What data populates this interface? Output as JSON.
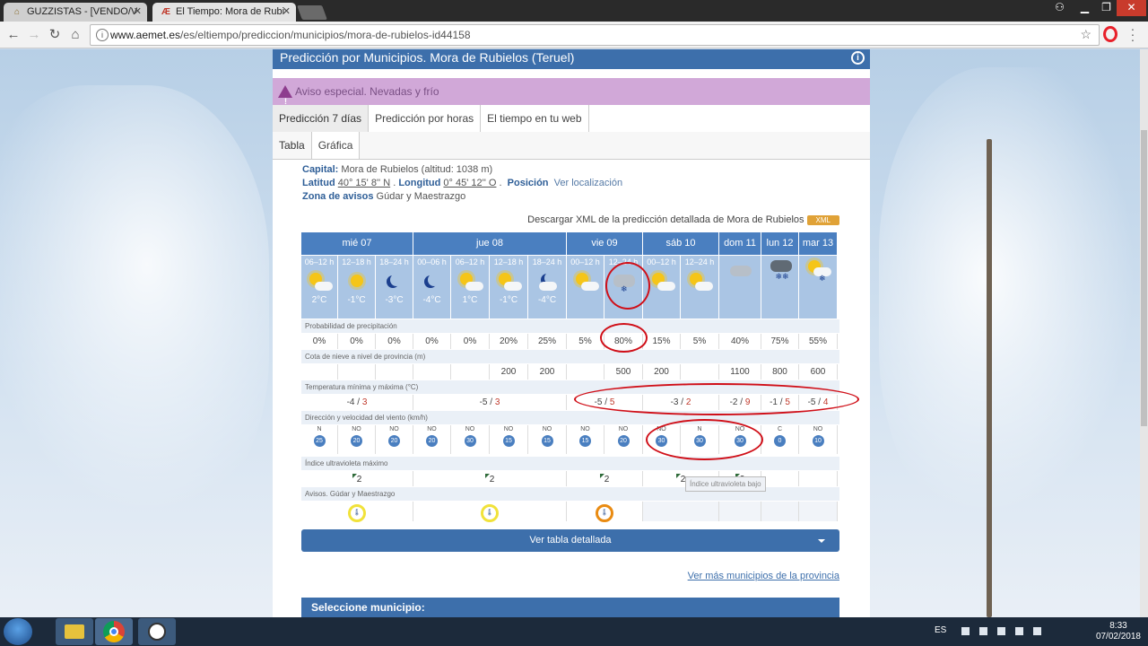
{
  "browser": {
    "tabs": [
      {
        "title": "GUZZISTAS - [VENDO/V",
        "active": false,
        "favicon": "guzzi-icon"
      },
      {
        "title": "El Tiempo: Mora de Rubi",
        "active": true,
        "favicon": "aemet-icon"
      }
    ],
    "url_domain": "www.aemet.es",
    "url_path": "/es/eltiempo/prediccion/municipios/mora-de-rubielos-id44158"
  },
  "page": {
    "header_title": "Predicción por Municipios. Mora de Rubielos (Teruel)",
    "alert_text": "Aviso especial. Nevadas y frío",
    "tabs_main": [
      "Predicción 7 días",
      "Predicción por horas",
      "El tiempo en tu web"
    ],
    "tabs_view": [
      "Tabla",
      "Gráfica"
    ],
    "info": {
      "capital_label": "Capital:",
      "capital_value": "Mora de Rubielos (altitud: 1038 m)",
      "lat_label": "Latitud",
      "lat_value": "40° 15' 8'' N",
      "lon_label": "Longitud",
      "lon_value": "0° 45' 12'' O",
      "pos_label": "Posición",
      "pos_link": "Ver localización",
      "zona_label": "Zona de avisos",
      "zona_value": "Gúdar y Maestrazgo"
    },
    "xml_text": "Descargar XML de la predicción detallada de Mora de Rubielos",
    "xml_badge": "XML",
    "detail_button": "Ver tabla detallada",
    "more_link": "Ver más municipios de la provincia",
    "select_header": "Seleccione municipio:",
    "tooltip": "Índice ultravioleta bajo"
  },
  "forecast": {
    "days": [
      "mié 07",
      "jue 08",
      "vie 09",
      "sáb 10",
      "dom 11",
      "lun 12",
      "mar 13"
    ],
    "slots": [
      {
        "period": "06–12 h",
        "sky": "sun-cloud",
        "temp": "2°C"
      },
      {
        "period": "12–18 h",
        "sky": "sun",
        "temp": "-1°C"
      },
      {
        "period": "18–24 h",
        "sky": "moon",
        "temp": "-3°C"
      },
      {
        "period": "00–06 h",
        "sky": "moon",
        "temp": "-4°C"
      },
      {
        "period": "06–12 h",
        "sky": "sun-cloud",
        "temp": "1°C"
      },
      {
        "period": "12–18 h",
        "sky": "sun-cloud",
        "temp": "-1°C"
      },
      {
        "period": "18–24 h",
        "sky": "moon-cloud",
        "temp": "-4°C"
      },
      {
        "period": "00–12 h",
        "sky": "sun-cloud",
        "temp": ""
      },
      {
        "period": "12–24 h",
        "sky": "snow-cloud",
        "temp": ""
      },
      {
        "period": "00–12 h",
        "sky": "sun-cloud",
        "temp": ""
      },
      {
        "period": "12–24 h",
        "sky": "sun-cloud",
        "temp": ""
      },
      {
        "period": "",
        "sky": "cloud",
        "temp": ""
      },
      {
        "period": "",
        "sky": "snow-dark",
        "temp": ""
      },
      {
        "period": "",
        "sky": "sun-snow",
        "temp": ""
      }
    ],
    "labels": {
      "precip": "Probabilidad de precipitación",
      "snow": "Cota de nieve a nivel de provincia (m)",
      "temp": "Temperatura mínima y máxima (°C)",
      "wind": "Dirección y velocidad del viento (km/h)",
      "uv": "Índice ultravioleta máximo",
      "avisos": "Avisos. Gúdar y Maestrazgo"
    },
    "precip": [
      "0%",
      "0%",
      "0%",
      "0%",
      "0%",
      "20%",
      "25%",
      "5%",
      "80%",
      "15%",
      "5%",
      "40%",
      "75%",
      "55%"
    ],
    "snow": [
      "",
      "",
      "",
      "",
      "",
      "200",
      "200",
      "",
      "500",
      "200",
      "",
      "1100",
      "800",
      "600"
    ],
    "temps": [
      {
        "min": "-4",
        "max": "3"
      },
      {
        "min": "-5",
        "max": "3"
      },
      {
        "min": "-5",
        "max": "5"
      },
      {
        "min": "-3",
        "max": "2"
      },
      {
        "min": "-2",
        "max": "9"
      },
      {
        "min": "-1",
        "max": "5"
      },
      {
        "min": "-5",
        "max": "4"
      }
    ],
    "wind": [
      {
        "dir": "N",
        "speed": "25"
      },
      {
        "dir": "NO",
        "speed": "20"
      },
      {
        "dir": "NO",
        "speed": "20"
      },
      {
        "dir": "NO",
        "speed": "20"
      },
      {
        "dir": "NO",
        "speed": "30"
      },
      {
        "dir": "NO",
        "speed": "15"
      },
      {
        "dir": "NO",
        "speed": "15"
      },
      {
        "dir": "NO",
        "speed": "15"
      },
      {
        "dir": "NO",
        "speed": "20"
      },
      {
        "dir": "NO",
        "speed": "30"
      },
      {
        "dir": "N",
        "speed": "30"
      },
      {
        "dir": "NO",
        "speed": "30"
      },
      {
        "dir": "C",
        "speed": "0"
      },
      {
        "dir": "NO",
        "speed": "10"
      }
    ],
    "uv": [
      "2",
      "2",
      "2",
      "2",
      "2",
      "",
      ""
    ],
    "avisos": [
      "yellow",
      "yellow",
      "orange",
      "",
      "",
      "",
      ""
    ]
  },
  "taskbar": {
    "lang": "ES",
    "time": "8:33",
    "date": "07/02/2018"
  }
}
